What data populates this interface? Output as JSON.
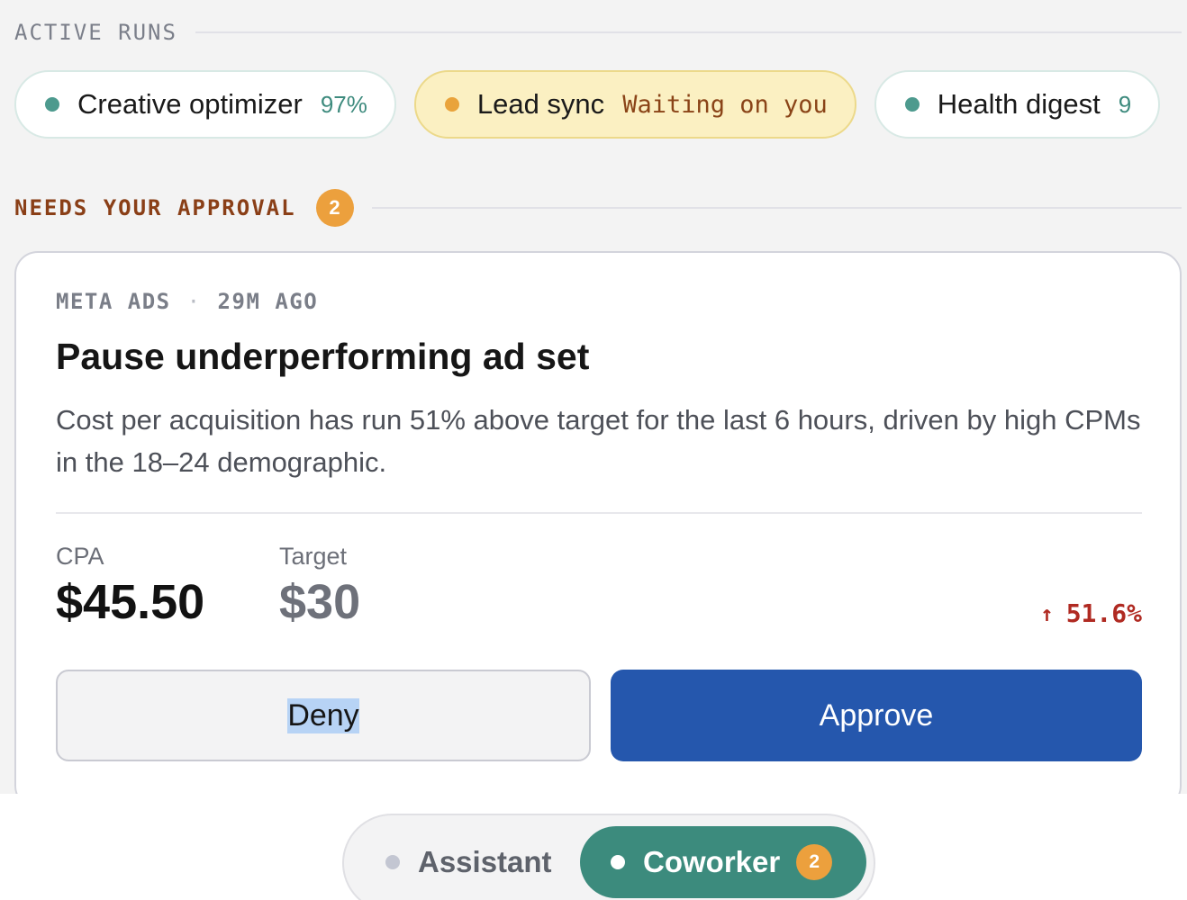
{
  "active_runs": {
    "heading": "ACTIVE RUNS",
    "items": [
      {
        "name": "Creative optimizer",
        "meta": "97%",
        "status": "running"
      },
      {
        "name": "Lead sync",
        "meta": "Waiting on you",
        "status": "waiting"
      },
      {
        "name": "Health digest",
        "meta": "9",
        "status": "running"
      }
    ]
  },
  "approvals": {
    "heading": "NEEDS YOUR APPROVAL",
    "count": "2",
    "card": {
      "source": "META ADS",
      "separator": "·",
      "time": "29M AGO",
      "title": "Pause underperforming ad set",
      "description": "Cost per acquisition has run 51% above target for the last 6 hours, driven by high CPMs in the 18–24 demographic.",
      "metrics": [
        {
          "label": "CPA",
          "value": "$45.50"
        },
        {
          "label": "Target",
          "value": "$30"
        }
      ],
      "delta_arrow": "↑",
      "delta": "51.6%",
      "deny_label": "Deny",
      "approve_label": "Approve"
    }
  },
  "bottom_nav": {
    "assistant_label": "Assistant",
    "coworker_label": "Coworker",
    "coworker_badge": "2"
  },
  "colors": {
    "accent_blue": "#2557ad",
    "accent_teal": "#3c8b7d",
    "badge_orange": "#eca03d",
    "warning_bg": "#fbf0c2",
    "danger_red": "#b02a22",
    "section_brown": "#8a3f17"
  }
}
